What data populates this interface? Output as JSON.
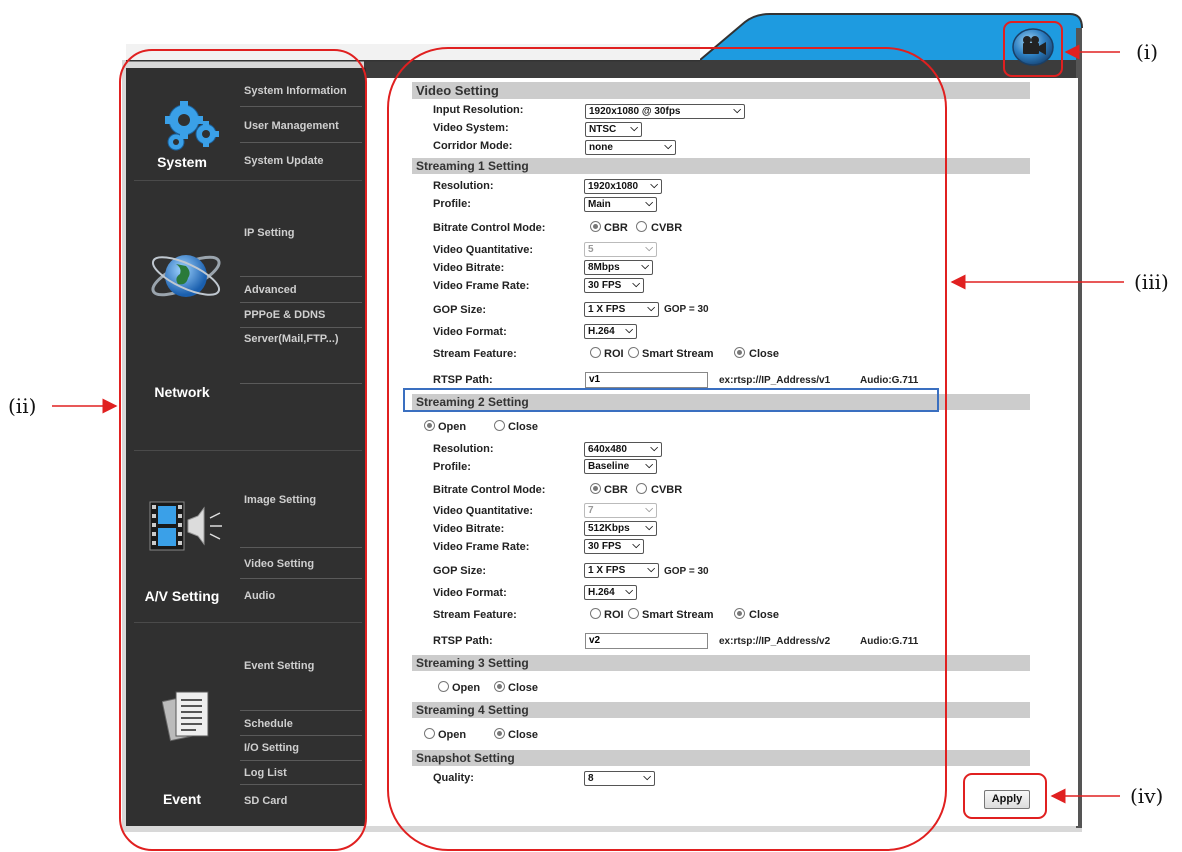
{
  "sidebar": {
    "system": {
      "title": "System",
      "items": [
        "System Information",
        "User Management",
        "System Update"
      ]
    },
    "network": {
      "title": "Network",
      "items": [
        "IP Setting",
        "Advanced",
        "PPPoE & DDNS",
        "Server(Mail,FTP...)"
      ]
    },
    "av": {
      "title": "A/V Setting",
      "items": [
        "Image Setting",
        "Video Setting",
        "Audio"
      ]
    },
    "event": {
      "title": "Event",
      "items": [
        "Event Setting",
        "Schedule",
        "I/O Setting",
        "Log List",
        "SD Card"
      ]
    }
  },
  "video_setting": {
    "header": "Video Setting",
    "input_resolution": {
      "label": "Input Resolution:",
      "value": "1920x1080 @ 30fps"
    },
    "video_system": {
      "label": "Video System:",
      "value": "NTSC"
    },
    "corridor_mode": {
      "label": "Corridor Mode:",
      "value": "none"
    }
  },
  "stream1": {
    "header": "Streaming 1 Setting",
    "resolution": {
      "label": "Resolution:",
      "value": "1920x1080"
    },
    "profile": {
      "label": "Profile:",
      "value": "Main"
    },
    "bitrate_mode": {
      "label": "Bitrate Control Mode:",
      "cbr": "CBR",
      "cvbr": "CVBR",
      "selected": "CBR"
    },
    "quantitative": {
      "label": "Video Quantitative:",
      "value": "5"
    },
    "bitrate": {
      "label": "Video Bitrate:",
      "value": "8Mbps"
    },
    "frame_rate": {
      "label": "Video Frame Rate:",
      "value": "30 FPS"
    },
    "gop": {
      "label": "GOP Size:",
      "value": "1 X FPS",
      "note": "GOP = 30"
    },
    "format": {
      "label": "Video Format:",
      "value": "H.264"
    },
    "feature": {
      "label": "Stream Feature:",
      "roi": "ROI",
      "smart": "Smart Stream",
      "close": "Close",
      "selected": "Close"
    },
    "rtsp": {
      "label": "RTSP Path:",
      "value": "v1",
      "example": "ex:rtsp://IP_Address/v1",
      "audio": "Audio:G.711"
    }
  },
  "stream2": {
    "header": "Streaming 2 Setting",
    "open": "Open",
    "close": "Close",
    "state": "Open",
    "resolution": {
      "label": "Resolution:",
      "value": "640x480"
    },
    "profile": {
      "label": "Profile:",
      "value": "Baseline"
    },
    "bitrate_mode": {
      "label": "Bitrate Control Mode:",
      "cbr": "CBR",
      "cvbr": "CVBR",
      "selected": "CBR"
    },
    "quantitative": {
      "label": "Video Quantitative:",
      "value": "7"
    },
    "bitrate": {
      "label": "Video Bitrate:",
      "value": "512Kbps"
    },
    "frame_rate": {
      "label": "Video Frame Rate:",
      "value": "30 FPS"
    },
    "gop": {
      "label": "GOP Size:",
      "value": "1 X FPS",
      "note": "GOP = 30"
    },
    "format": {
      "label": "Video Format:",
      "value": "H.264"
    },
    "feature": {
      "label": "Stream Feature:",
      "roi": "ROI",
      "smart": "Smart Stream",
      "close": "Close",
      "selected": "Close"
    },
    "rtsp": {
      "label": "RTSP Path:",
      "value": "v2",
      "example": "ex:rtsp://IP_Address/v2",
      "audio": "Audio:G.711"
    }
  },
  "stream3": {
    "header": "Streaming 3 Setting",
    "open": "Open",
    "close": "Close",
    "state": "Close"
  },
  "stream4": {
    "header": "Streaming 4 Setting",
    "open": "Open",
    "close": "Close",
    "state": "Close"
  },
  "snapshot": {
    "header": "Snapshot Setting",
    "quality": {
      "label": "Quality:",
      "value": "8"
    }
  },
  "apply_label": "Apply",
  "annotations": {
    "i": "(i)",
    "ii": "(ii)",
    "iii": "(iii)",
    "iv": "(iv)"
  },
  "colors": {
    "sidebar": "#303030",
    "header_blue": "#1e9be0",
    "annotation_red": "#e02020",
    "highlight_blue": "#3a6fc0"
  }
}
